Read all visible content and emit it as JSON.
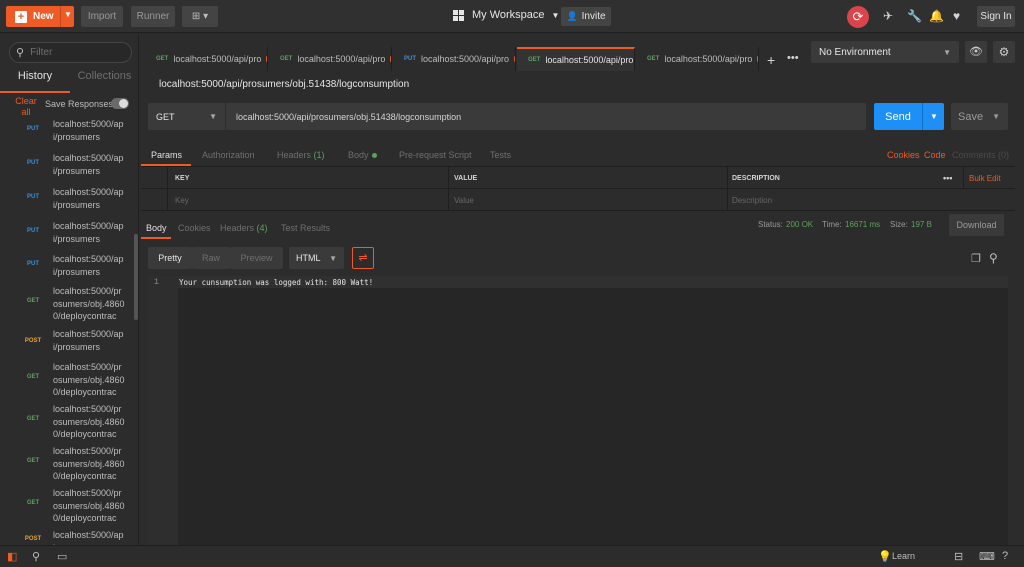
{
  "topbar": {
    "new_label": "New",
    "import_label": "Import",
    "runner_label": "Runner",
    "workspace_label": "My Workspace",
    "invite_label": "Invite",
    "signin_label": "Sign In"
  },
  "sidebar": {
    "filter_placeholder": "Filter",
    "tab_history": "History",
    "tab_collections": "Collections",
    "clear_all": "Clear all",
    "save_responses": "Save Responses",
    "items": [
      {
        "method": "PUT",
        "url": "localhost:5000/api/prosumers",
        "color": "#3b8ed8"
      },
      {
        "method": "PUT",
        "url": "localhost:5000/api/prosumers",
        "color": "#3b8ed8"
      },
      {
        "method": "PUT",
        "url": "localhost:5000/api/prosumers",
        "color": "#3b8ed8"
      },
      {
        "method": "PUT",
        "url": "localhost:5000/api/prosumers",
        "color": "#3b8ed8"
      },
      {
        "method": "PUT",
        "url": "localhost:5000/api/prosumers",
        "color": "#3b8ed8"
      },
      {
        "method": "GET",
        "url": "localhost:5000/prosumers/obj.48600/deploycontrac",
        "color": "#5ba35b"
      },
      {
        "method": "POST",
        "url": "localhost:5000/api/prosumers",
        "color": "#e6a23c"
      },
      {
        "method": "GET",
        "url": "localhost:5000/prosumers/obj.48600/deploycontrac",
        "color": "#5ba35b"
      },
      {
        "method": "GET",
        "url": "localhost:5000/prosumers/obj.48600/deploycontrac",
        "color": "#5ba35b"
      },
      {
        "method": "GET",
        "url": "localhost:5000/prosumers/obj.48600/deploycontrac",
        "color": "#5ba35b"
      },
      {
        "method": "GET",
        "url": "localhost:5000/prosumers/obj.48600/deploycontrac",
        "color": "#5ba35b"
      },
      {
        "method": "POST",
        "url": "localhost:5000/api",
        "color": "#e6a23c"
      }
    ]
  },
  "tabs": [
    {
      "method": "GET",
      "label": "localhost:5000/api/pro"
    },
    {
      "method": "GET",
      "label": "localhost:5000/api/pro"
    },
    {
      "method": "PUT",
      "label": "localhost:5000/api/pro"
    },
    {
      "method": "GET",
      "label": "localhost:5000/api/pro"
    },
    {
      "method": "GET",
      "label": "localhost:5000/api/pro"
    }
  ],
  "environment": {
    "selected": "No Environment"
  },
  "request": {
    "title": "localhost:5000/api/prosumers/obj.51438/logconsumption",
    "method": "GET",
    "url": "localhost:5000/api/prosumers/obj.51438/logconsumption",
    "send_label": "Send",
    "save_label": "Save"
  },
  "param_tabs": {
    "params": "Params",
    "authorization": "Authorization",
    "headers": "Headers",
    "headers_count": "(1)",
    "body": "Body",
    "prerequest": "Pre-request Script",
    "tests": "Tests",
    "cookies": "Cookies",
    "code": "Code",
    "comments": "Comments (0)"
  },
  "params_table": {
    "col_key": "KEY",
    "col_value": "VALUE",
    "col_description": "DESCRIPTION",
    "more": "•••",
    "bulk_edit": "Bulk Edit",
    "ph_key": "Key",
    "ph_value": "Value",
    "ph_description": "Description"
  },
  "response_tabs": {
    "body": "Body",
    "cookies": "Cookies",
    "headers": "Headers",
    "headers_count": "(4)",
    "test_results": "Test Results"
  },
  "response_status": {
    "status_label": "Status:",
    "status_value": "200 OK",
    "time_label": "Time:",
    "time_value": "16671 ms",
    "size_label": "Size:",
    "size_value": "197 B",
    "download_label": "Download"
  },
  "format_bar": {
    "pretty": "Pretty",
    "raw": "Raw",
    "preview": "Preview",
    "format": "HTML"
  },
  "response_body": {
    "line_number": "1",
    "line_text": "Your cunsumption was logged with: 800 Watt!"
  },
  "bottombar": {
    "learn_label": "Learn"
  }
}
